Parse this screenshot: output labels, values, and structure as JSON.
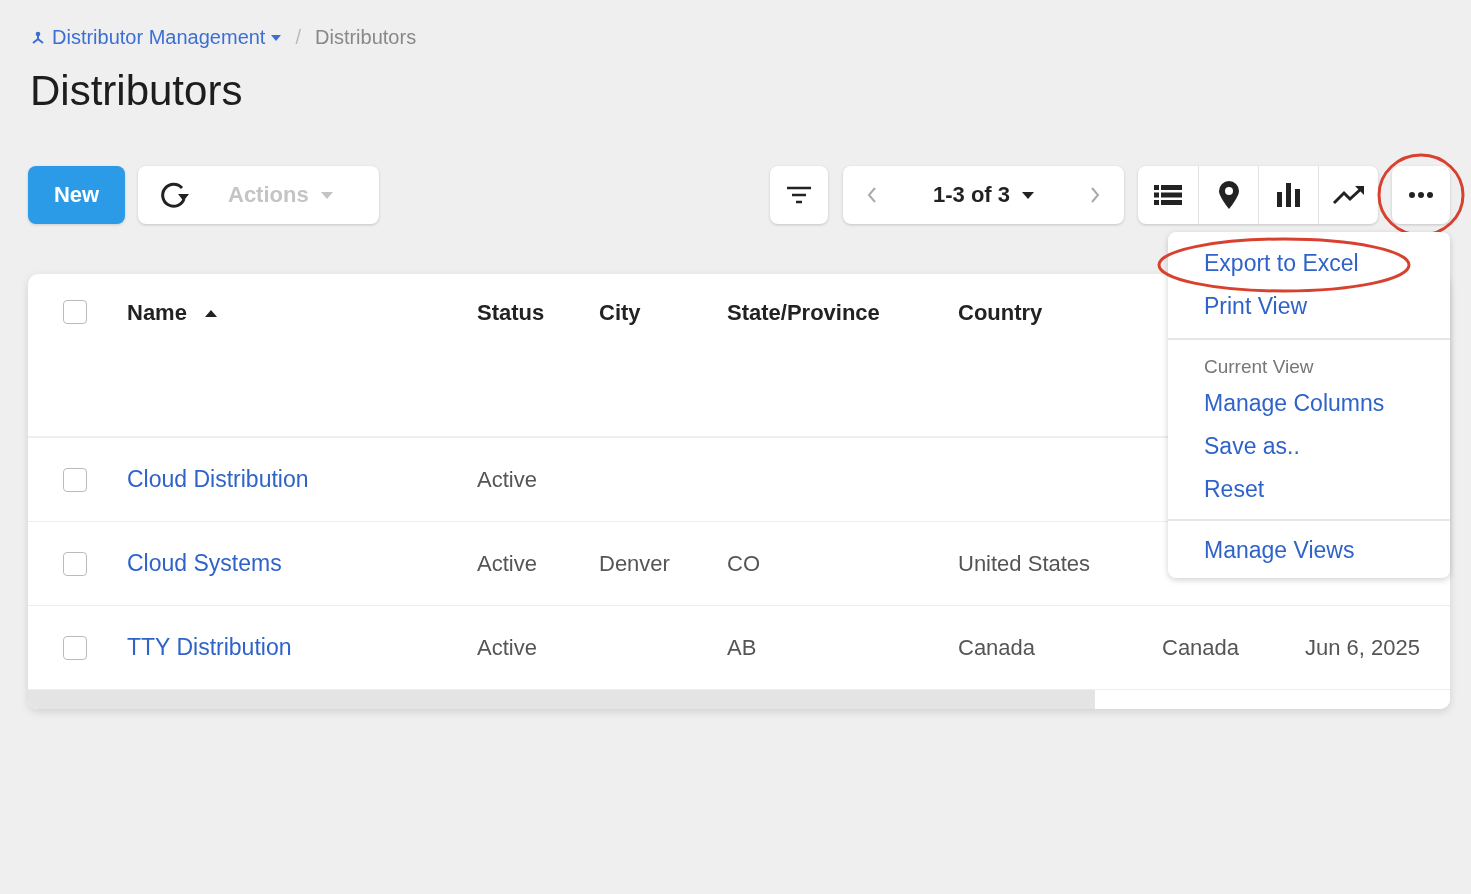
{
  "breadcrumb": {
    "parent": "Distributor Management",
    "separator": "/",
    "current": "Distributors"
  },
  "title": "Distributors",
  "toolbar": {
    "new_button": "New",
    "actions_button": "Actions",
    "actions_disabled": true,
    "pager": "1-3 of 3",
    "more_highlighted": true
  },
  "table": {
    "columns": [
      {
        "label": "Name",
        "sort_ascending": true
      },
      {
        "label": "Status",
        "sort_ascending": false
      },
      {
        "label": "City",
        "sort_ascending": false
      },
      {
        "label": "State/Province",
        "sort_ascending": false
      },
      {
        "label": "Country",
        "sort_ascending": false
      }
    ],
    "header_checked": false,
    "rows": [
      {
        "name": "Cloud Distribution",
        "status": "Active",
        "checked": false
      },
      {
        "name": "Cloud Systems",
        "status": "Active",
        "city": "Denver",
        "state": "CO",
        "country": "United States",
        "checked": false
      },
      {
        "name": "TTY Distribution",
        "status": "Active",
        "state": "AB",
        "country": "Canada",
        "column_6": "Canada",
        "column_7": "Jun 6, 2025",
        "checked": false
      }
    ],
    "scroll": {
      "level": 0.75
    }
  },
  "menu": {
    "groups": [
      {
        "items": [
          {
            "label": "Export to Excel",
            "highlighted": true
          },
          {
            "label": "Print View",
            "highlighted": false
          }
        ]
      },
      {
        "heading": "Current View",
        "items": [
          {
            "label": "Manage Columns",
            "highlighted": false
          },
          {
            "label": "Save as..",
            "highlighted": false
          },
          {
            "label": "Reset",
            "highlighted": false
          }
        ]
      },
      {
        "items": [
          {
            "label": "Manage Views",
            "highlighted": false
          }
        ]
      }
    ]
  }
}
